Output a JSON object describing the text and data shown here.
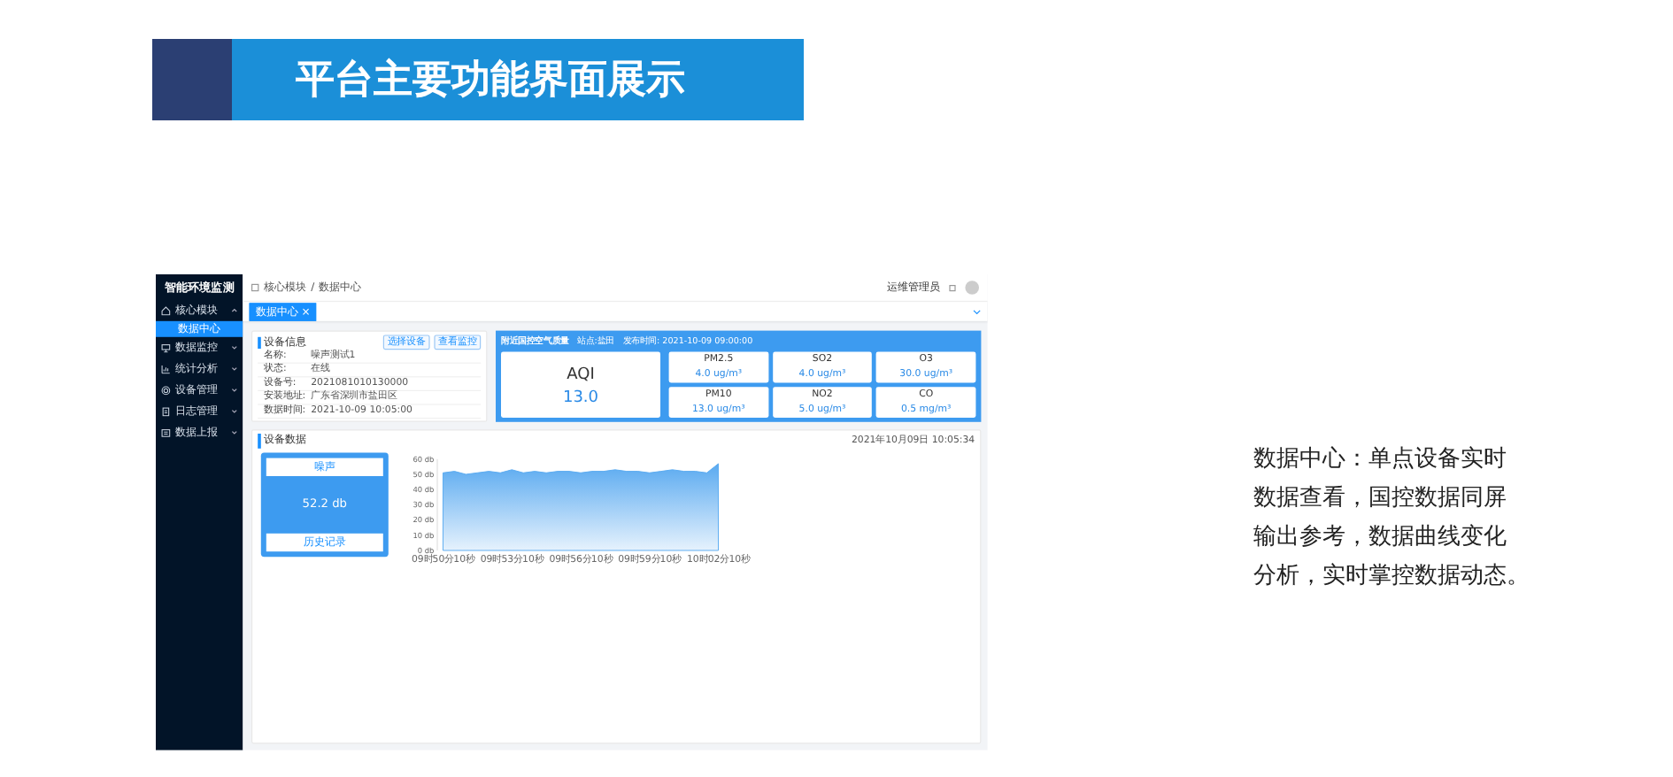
{
  "banner": {
    "title": "平台主要功能界面展示"
  },
  "app": {
    "sidebar": {
      "title": "智能环境监测",
      "items": [
        {
          "label": "核心模块",
          "expanded": true,
          "children": [
            {
              "label": "数据中心",
              "selected": true
            }
          ]
        },
        {
          "label": "数据监控",
          "expanded": false
        },
        {
          "label": "统计分析",
          "expanded": false
        },
        {
          "label": "设备管理",
          "expanded": false
        },
        {
          "label": "日志管理",
          "expanded": false
        },
        {
          "label": "数据上报",
          "expanded": false
        }
      ]
    },
    "breadcrumb": [
      "核心模块",
      "/",
      "数据中心"
    ],
    "user": "运维管理员",
    "tabs": [
      {
        "label": "数据中心",
        "close": "×",
        "selected": true
      }
    ],
    "device_info": {
      "title": "设备信息",
      "buttons": [
        "选择设备",
        "查看监控"
      ],
      "fields": [
        {
          "label": "名称:",
          "value": "噪声测试1"
        },
        {
          "label": "状态:",
          "value": "在线"
        },
        {
          "label": "设备号:",
          "value": "2021081010130000"
        },
        {
          "label": "安装地址:",
          "value": "广东省深圳市盐田区"
        },
        {
          "label": "数据时间:",
          "value": "2021-10-09 10:05:00"
        }
      ]
    },
    "air": {
      "title": "附近国控空气质量",
      "station": "站点:盐田",
      "published": "发布时间: 2021-10-09 09:00:00",
      "aqi": {
        "label": "AQI",
        "value": "13.0"
      },
      "items": [
        {
          "label": "PM2.5",
          "value": "4.0 ug/m³"
        },
        {
          "label": "SO2",
          "value": "4.0 ug/m³"
        },
        {
          "label": "O3",
          "value": "30.0 ug/m³"
        },
        {
          "label": "PM10",
          "value": "13.0 ug/m³"
        },
        {
          "label": "NO2",
          "value": "5.0 ug/m³"
        },
        {
          "label": "CO",
          "value": "0.5 mg/m³"
        }
      ]
    },
    "device_data": {
      "title": "设备数据",
      "time": "2021年10月09日 10:05:34",
      "reading": {
        "label": "噪声",
        "value": "52.2 db",
        "link": "历史记录"
      },
      "chart": {
        "y_labels": [
          "60 db",
          "50 db",
          "40 db",
          "30 db",
          "20 db",
          "10 db",
          "0 db"
        ],
        "x_labels": [
          "09时50分10秒",
          "09时53分10秒",
          "09时56分10秒",
          "09时59分10秒",
          "10时02分10秒"
        ]
      }
    }
  },
  "description": {
    "lines": [
      "数据中心：单点设备实时",
      "数据查看，国控数据同屏",
      "输出参考，数据曲线变化",
      "分析，实时掌控数据动态。"
    ]
  }
}
